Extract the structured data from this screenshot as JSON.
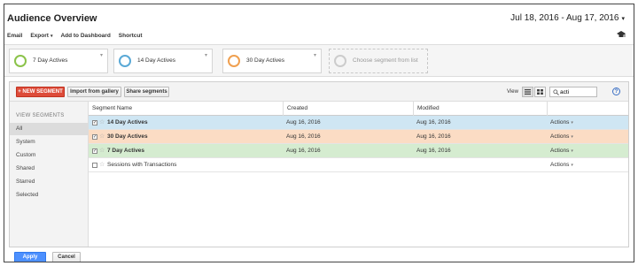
{
  "header": {
    "title": "Audience Overview",
    "date_range": "Jul 18, 2016 - Aug 17, 2016"
  },
  "toolbar": {
    "email": "Email",
    "export": "Export",
    "add_to_dashboard": "Add to Dashboard",
    "shortcut": "Shortcut"
  },
  "segments": [
    {
      "label": "7 Day Actives",
      "color": "#8bc34a"
    },
    {
      "label": "14 Day Actives",
      "color": "#5aa9d6"
    },
    {
      "label": "30 Day Actives",
      "color": "#f0a050"
    },
    {
      "label": "Choose segment from list",
      "color": "#cccccc"
    }
  ],
  "panel": {
    "new_segment": "+ NEW SEGMENT",
    "import_gallery": "Import from gallery",
    "share_segments": "Share segments",
    "view_label": "View",
    "search_value": "acti",
    "help": "?"
  },
  "sidebar": {
    "heading": "VIEW SEGMENTS",
    "items": [
      "All",
      "System",
      "Custom",
      "Shared",
      "Starred",
      "Selected"
    ]
  },
  "table": {
    "columns": [
      "Segment Name",
      "Created",
      "Modified",
      ""
    ],
    "rows": [
      {
        "name": "14 Day Actives",
        "created": "Aug 16, 2016",
        "modified": "Aug 16, 2016",
        "actions": "Actions",
        "checked": true,
        "bg": "#cfe6f3"
      },
      {
        "name": "30 Day Actives",
        "created": "Aug 16, 2016",
        "modified": "Aug 16, 2016",
        "actions": "Actions",
        "checked": true,
        "bg": "#fbdcc4"
      },
      {
        "name": "7 Day Actives",
        "created": "Aug 16, 2016",
        "modified": "Aug 16, 2016",
        "actions": "Actions",
        "checked": true,
        "bg": "#d5ecd0"
      },
      {
        "name": "Sessions with Transactions",
        "created": "",
        "modified": "",
        "actions": "Actions",
        "checked": false,
        "bg": "#ffffff"
      }
    ]
  },
  "footer": {
    "apply": "Apply",
    "cancel": "Cancel"
  }
}
